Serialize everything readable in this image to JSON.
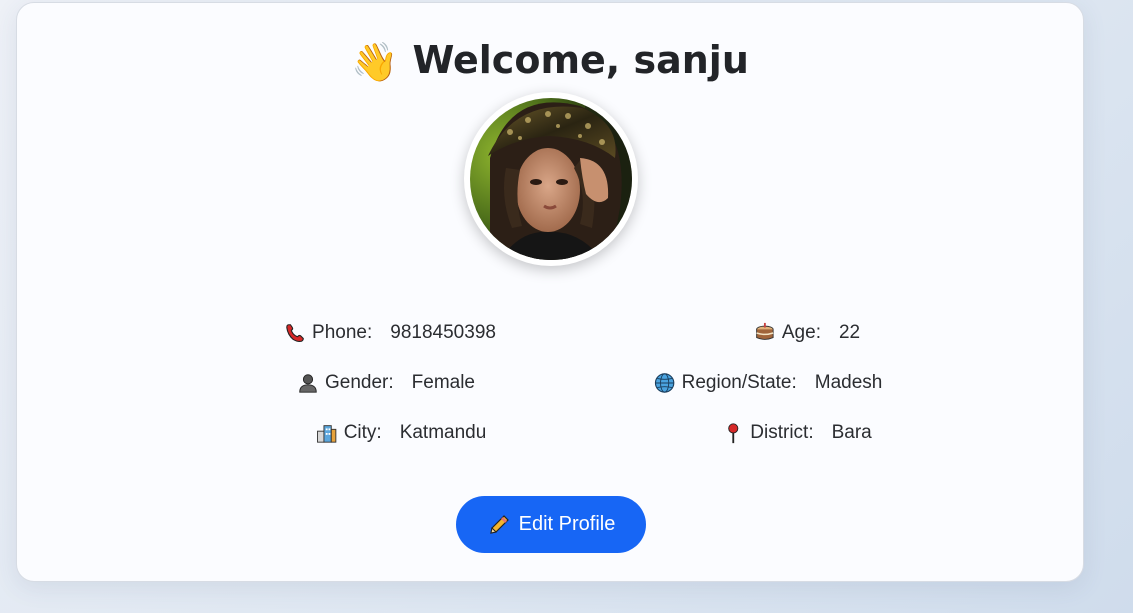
{
  "header": {
    "wave_emoji": "👋",
    "title": "Welcome, sanju"
  },
  "profile": {
    "avatar_alt": "profile photo",
    "fields": [
      {
        "key": "phone",
        "icon": "phone-icon",
        "label": "Phone:",
        "value": "9818450398"
      },
      {
        "key": "age",
        "icon": "cake-icon",
        "label": "Age:",
        "value": "22"
      },
      {
        "key": "gender",
        "icon": "person-icon",
        "label": "Gender:",
        "value": "Female"
      },
      {
        "key": "region",
        "icon": "globe-icon",
        "label": "Region/State:",
        "value": "Madesh"
      },
      {
        "key": "city",
        "icon": "city-icon",
        "label": "City:",
        "value": "Katmandu"
      },
      {
        "key": "district",
        "icon": "pin-icon",
        "label": "District:",
        "value": "Bara"
      }
    ]
  },
  "actions": {
    "edit_label": "Edit Profile",
    "edit_icon": "pencil-icon"
  },
  "colors": {
    "accent": "#1766f5",
    "card_bg": "#fbfcff",
    "text": "#2b2d31"
  }
}
